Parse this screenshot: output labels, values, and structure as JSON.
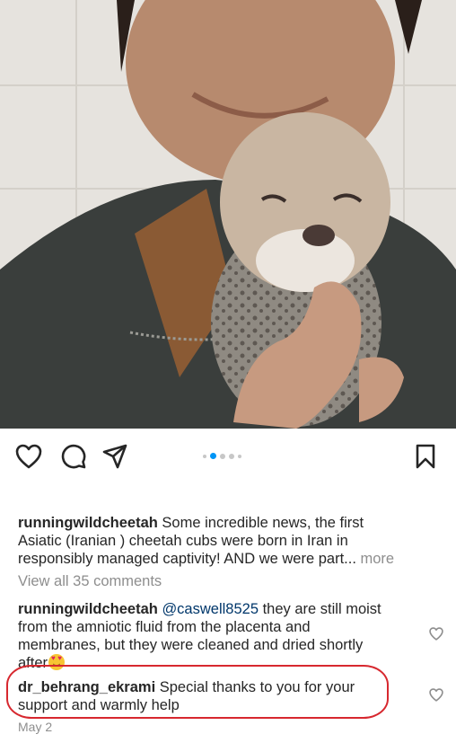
{
  "post": {
    "image_alt": "Man holding a newborn cheetah cub",
    "carousel": {
      "count": 5,
      "active_index": 1
    }
  },
  "actions": {
    "like_icon": "heart-outline-icon",
    "comment_icon": "comment-bubble-icon",
    "share_icon": "paper-plane-icon",
    "save_icon": "bookmark-outline-icon"
  },
  "caption": {
    "username": "runningwildcheetah",
    "text_line1": " Some incredible news, the first",
    "text_line2": "Asiatic (Iranian ) cheetah cubs were born in Iran in",
    "text_line3": "responsibly managed captivity! AND we were part...",
    "more_label": " more"
  },
  "view_all_comments": "View all 35 comments",
  "comments": [
    {
      "username": "runningwildcheetah",
      "mention": "@caswell8525",
      "text_line1": " they are still moist",
      "text_line2": "from the amniotic fluid from the placenta and",
      "text_line3": "membranes, but they were cleaned and dried shortly",
      "text_line4": "after",
      "emoji": "heart-eyes-emoji"
    },
    {
      "username": "dr_behrang_ekrami",
      "text_line1": " Special thanks to you for your",
      "text_line2": "support  and warmly help"
    }
  ],
  "date": "May 2",
  "colors": {
    "accent_dot": "#0095f6",
    "highlight_border": "#d7282f",
    "muted_text": "#8e8e8e"
  }
}
